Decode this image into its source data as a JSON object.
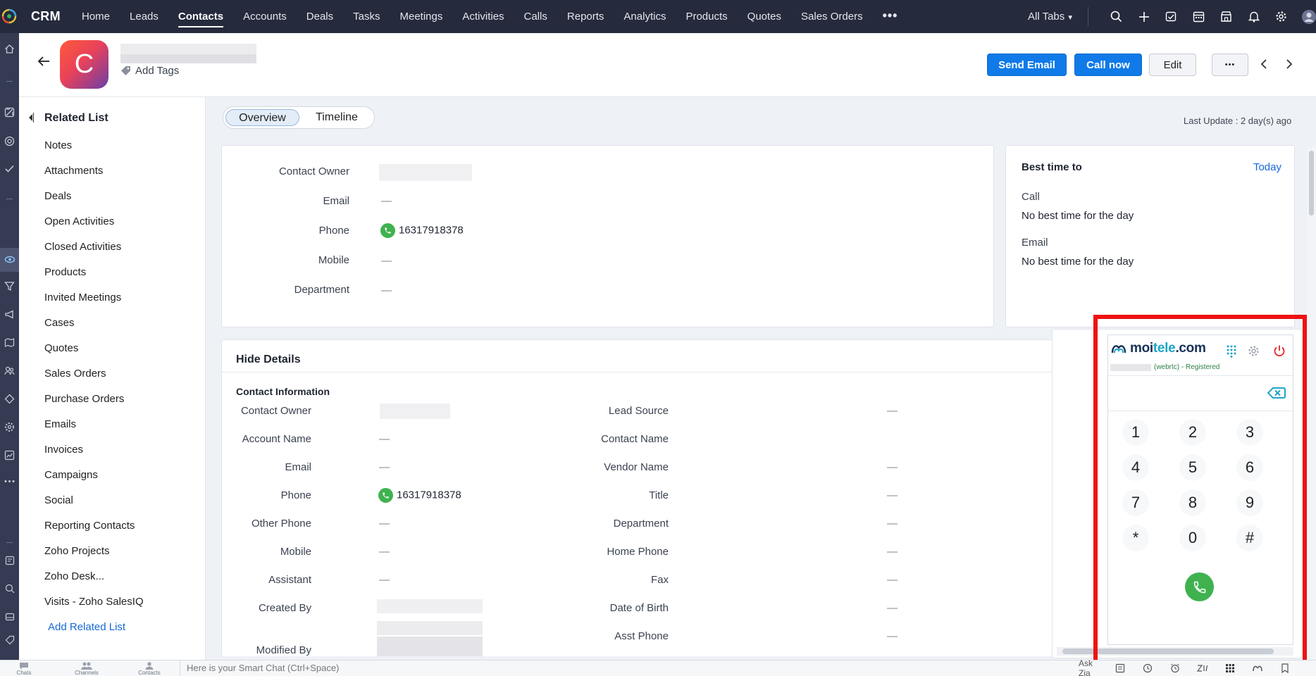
{
  "app": {
    "brand": "CRM"
  },
  "nav": {
    "tabs": [
      "Home",
      "Leads",
      "Contacts",
      "Accounts",
      "Deals",
      "Tasks",
      "Meetings",
      "Activities",
      "Calls",
      "Reports",
      "Analytics",
      "Products",
      "Quotes",
      "Sales Orders"
    ],
    "active": "Contacts",
    "more": "•••",
    "all_tabs": "All Tabs"
  },
  "record": {
    "avatar_letter": "C",
    "add_tags": "Add Tags",
    "actions": {
      "send_email": "Send Email",
      "call_now": "Call now",
      "edit": "Edit",
      "more": "•••"
    }
  },
  "related_list": {
    "title": "Related List",
    "items": [
      "Notes",
      "Attachments",
      "Deals",
      "Open Activities",
      "Closed Activities",
      "Products",
      "Invited Meetings",
      "Cases",
      "Quotes",
      "Sales Orders",
      "Purchase Orders",
      "Emails",
      "Invoices",
      "Campaigns",
      "Social",
      "Reporting Contacts",
      "Zoho Projects",
      "Zoho Desk...",
      "Visits - Zoho SalesIQ"
    ],
    "add": "Add Related List"
  },
  "view_tabs": {
    "overview": "Overview",
    "timeline": "Timeline"
  },
  "last_update": "Last Update : 2 day(s) ago",
  "overview": {
    "labels": {
      "owner": "Contact Owner",
      "email": "Email",
      "phone": "Phone",
      "mobile": "Mobile",
      "department": "Department"
    },
    "values": {
      "email": "—",
      "phone": "16317918378",
      "mobile": "—",
      "department": "—"
    }
  },
  "best_time": {
    "title": "Best time to",
    "today": "Today",
    "call_label": "Call",
    "call_value": "No best time for the day",
    "email_label": "Email",
    "email_value": "No best time for the day"
  },
  "details": {
    "hide": "Hide Details",
    "section": "Contact Information",
    "left": [
      {
        "label": "Contact Owner",
        "value": ""
      },
      {
        "label": "Account Name",
        "value": "—"
      },
      {
        "label": "Email",
        "value": "—"
      },
      {
        "label": "Phone",
        "value": "16317918378"
      },
      {
        "label": "Other Phone",
        "value": "—"
      },
      {
        "label": "Mobile",
        "value": "—"
      },
      {
        "label": "Assistant",
        "value": "—"
      },
      {
        "label": "Created By",
        "value": ""
      },
      {
        "label": "Modified By",
        "value": ""
      }
    ],
    "right": [
      {
        "label": "Lead Source",
        "value": "—"
      },
      {
        "label": "Contact Name",
        "value": ""
      },
      {
        "label": "Vendor Name",
        "value": "—"
      },
      {
        "label": "Title",
        "value": "—"
      },
      {
        "label": "Department",
        "value": "—"
      },
      {
        "label": "Home Phone",
        "value": "—"
      },
      {
        "label": "Fax",
        "value": "—"
      },
      {
        "label": "Date of Birth",
        "value": "—"
      },
      {
        "label": "Asst Phone",
        "value": "—"
      }
    ]
  },
  "dialer": {
    "logo_a": "moi",
    "logo_b": "tele",
    "logo_c": ".com",
    "status": "(webrtc) - Registered",
    "keys": [
      "1",
      "2",
      "3",
      "4",
      "5",
      "6",
      "7",
      "8",
      "9",
      "*",
      "0",
      "#"
    ]
  },
  "bottom": {
    "chats": "Chats",
    "channels": "Channels",
    "contacts": "Contacts",
    "smartchat_placeholder": "Here is your Smart Chat (Ctrl+Space)",
    "ask_zia": "Ask Zia"
  },
  "colors": {
    "primary": "#0f7ae8",
    "topbar": "#252a3c",
    "phone_green": "#3fb24f",
    "highlight": "#ee1212"
  }
}
